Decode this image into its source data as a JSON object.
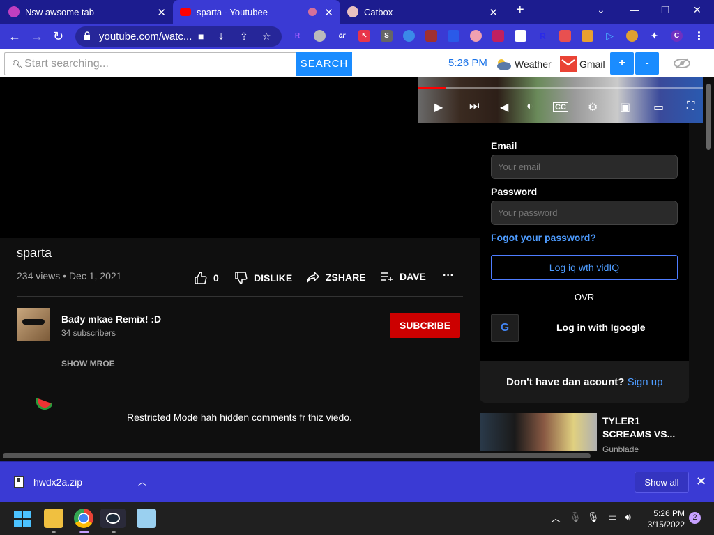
{
  "tabs": [
    {
      "title": "Nsw awsome tab"
    },
    {
      "title": "sparta - Youtubee"
    },
    {
      "title": "Catbox"
    }
  ],
  "toolbar": {
    "url": "youtube.com/watc...",
    "extensions": [
      "R",
      "cr",
      "S",
      "R",
      "C"
    ]
  },
  "searchbar": {
    "placeholder": "Start searching...",
    "button_label": "SEARCH",
    "clock": "5:26 PM",
    "weather_label": "Weather",
    "gmail_label": "Gmail",
    "zoom_in": "+",
    "zoom_out": "-"
  },
  "video": {
    "title": "sparta",
    "meta": "234 views • Dec 1, 2021",
    "likes": "0",
    "dislike_label": "DISLIKE",
    "share_label": "ZSHARE",
    "save_label": "DAVE",
    "more_label": "···"
  },
  "channel": {
    "name": "Bady mkae Remix! :D",
    "subscribers": "34 subscribers",
    "subscribe_label": "SUBCRIBE",
    "show_more": "SHOW MROE"
  },
  "comments": {
    "restricted_notice": "Restricted Mode hah hidden comments fr thiz viedo."
  },
  "login": {
    "email_label": "Email",
    "email_placeholder": "Your email",
    "password_label": "Password",
    "password_placeholder": "Your password",
    "forgot": "Fogot your password?",
    "vidiq_button": "Log iq wth vidIQ",
    "or": "OVR",
    "google_button": "Log in with Igoogle",
    "no_account": "Don't have dan acount?",
    "signup": "Sign up"
  },
  "recommended": {
    "title": "TYLER1 SCREAMS VS...",
    "channel": "Gunblade"
  },
  "downloads": {
    "file": "hwdx2a.zip",
    "show_all": "Show all"
  },
  "taskbar": {
    "time": "5:26 PM",
    "date": "3/15/2022",
    "notification_count": "2"
  },
  "colors": {
    "accent_blue": "#3a3ad4",
    "subscribe_red": "#cc0000",
    "link_blue": "#4e9cff"
  }
}
